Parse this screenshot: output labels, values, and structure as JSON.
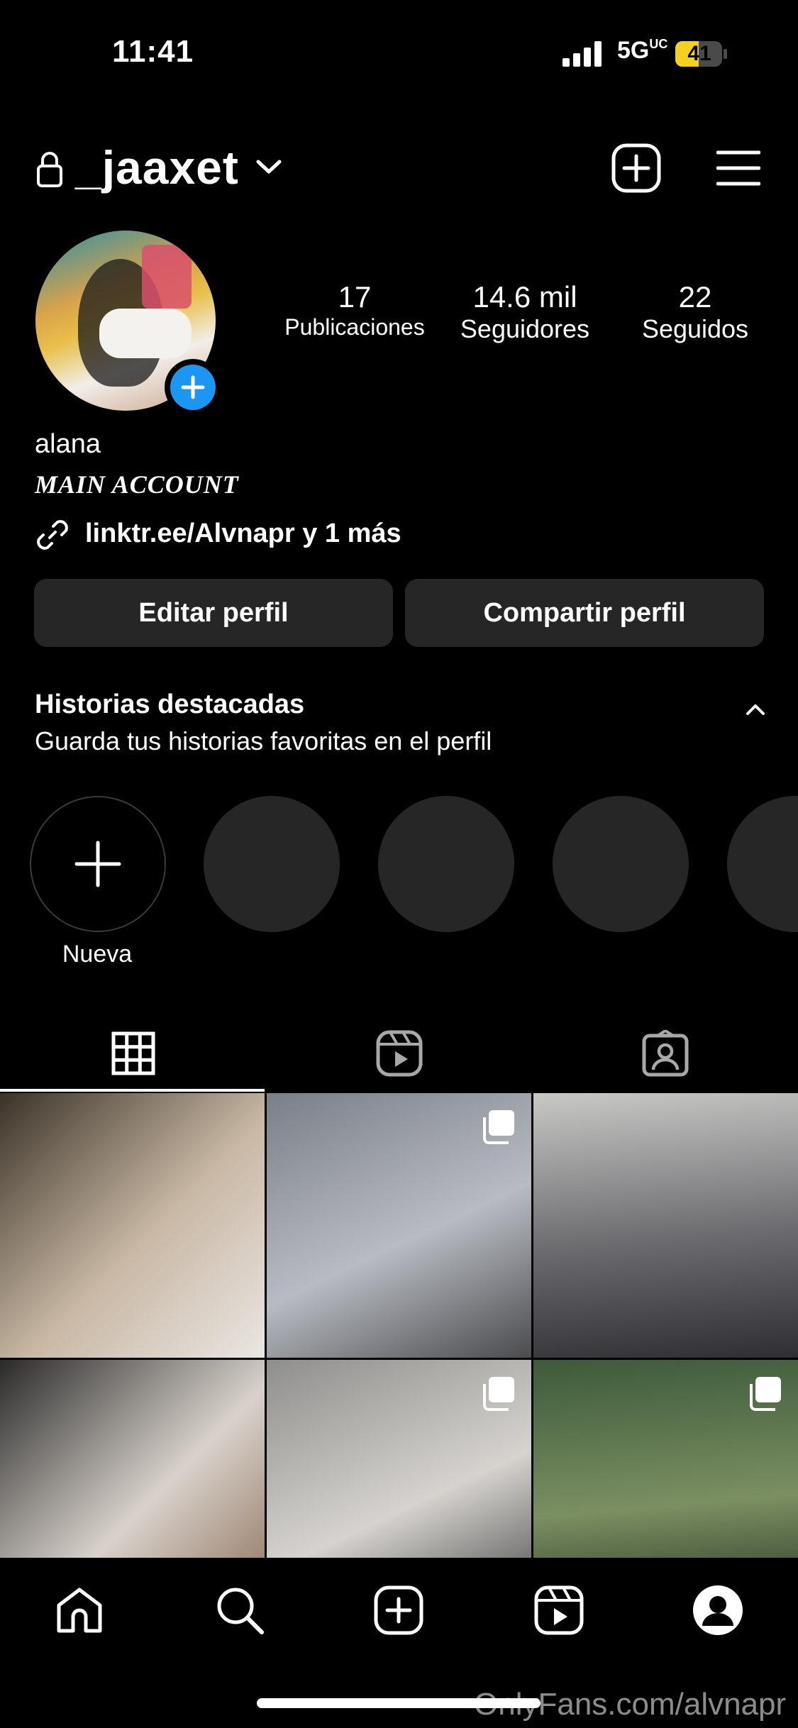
{
  "status_bar": {
    "time": "11:41",
    "network": "5G",
    "network_sup": "UC",
    "battery": "41"
  },
  "header": {
    "username": "_jaaxet"
  },
  "profile": {
    "stats": [
      {
        "value": "17",
        "label": "Publicaciones"
      },
      {
        "value": "14.6 mil",
        "label": "Seguidores"
      },
      {
        "value": "22",
        "label": "Seguidos"
      }
    ],
    "name": "alana",
    "bio": "MAIN ACCOUNT",
    "link": "linktr.ee/Alvnapr y 1 más"
  },
  "buttons": {
    "edit": "Editar perfil",
    "share": "Compartir perfil"
  },
  "highlights": {
    "title": "Historias destacadas",
    "subtitle": "Guarda tus historias favoritas en el perfil",
    "new_label": "Nueva"
  },
  "tabs": [
    "grid",
    "reels",
    "tagged"
  ],
  "grid_posts": [
    {
      "type": "photo",
      "colors": [
        "#3b3328",
        "#c9b8a5",
        "#e9e6e2"
      ]
    },
    {
      "type": "carousel",
      "colors": [
        "#7a7f86",
        "#b8bcc2",
        "#4b4b4e"
      ]
    },
    {
      "type": "photo",
      "colors": [
        "#c8c8c6",
        "#6c6c70",
        "#2f2f33"
      ]
    },
    {
      "type": "photo",
      "colors": [
        "#2a2a2a",
        "#d8d2cb",
        "#8a6b55"
      ]
    },
    {
      "type": "carousel",
      "colors": [
        "#8e8e8c",
        "#d6d3cf",
        "#3d3d3d"
      ]
    },
    {
      "type": "carousel",
      "colors": [
        "#3d5a3a",
        "#7b8f62",
        "#1f2b1c"
      ]
    }
  ],
  "watermark": "OnlyFans.com/alvnapr",
  "colors": {
    "accent": "#1b97f3",
    "button_bg": "#262626",
    "highlight_bg": "#262626"
  }
}
